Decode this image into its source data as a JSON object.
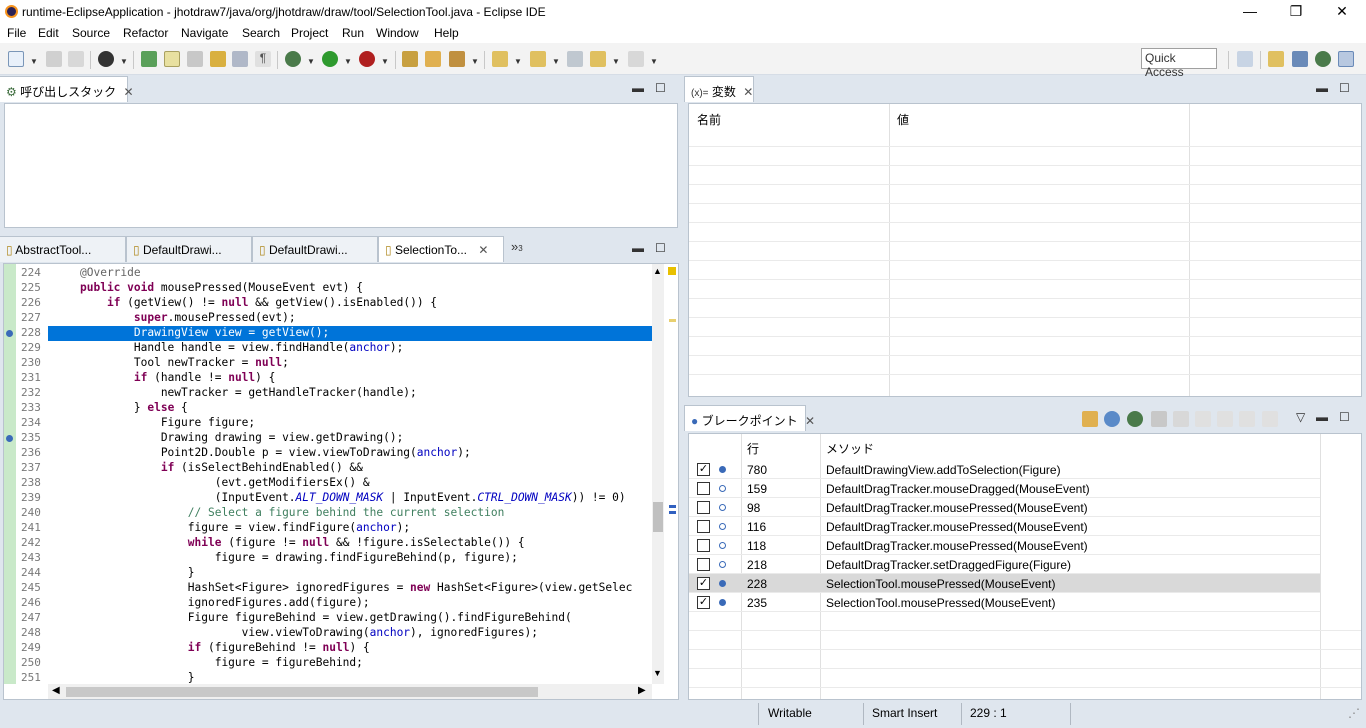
{
  "window": {
    "title": "runtime-EclipseApplication - jhotdraw7/java/org/jhotdraw/draw/tool/SelectionTool.java - Eclipse IDE",
    "minimize": "—",
    "maximize": "❐",
    "close": "✕"
  },
  "menu": [
    "File",
    "Edit",
    "Source",
    "Refactor",
    "Navigate",
    "Search",
    "Project",
    "Run",
    "Window",
    "Help"
  ],
  "toolbar": {
    "quick_access": "Quick Access"
  },
  "callstack": {
    "title": "呼び出しスタック"
  },
  "variables": {
    "title": "変数",
    "prefix": "(x)=",
    "col_name": "名前",
    "col_value": "値"
  },
  "editor": {
    "tabs": [
      "AbstractTool...",
      "DefaultDrawi...",
      "DefaultDrawi...",
      "SelectionTo..."
    ],
    "overflow": "»",
    "overflow_count": "3",
    "highlight_line": "228",
    "lines": [
      {
        "n": "224",
        "t": "@Override"
      },
      {
        "n": "225",
        "t": "public void mousePressed(MouseEvent evt) {"
      },
      {
        "n": "226",
        "t": "    if (getView() != null && getView().isEnabled()) {"
      },
      {
        "n": "227",
        "t": "        super.mousePressed(evt);"
      },
      {
        "n": "228",
        "t": "        DrawingView view = getView();"
      },
      {
        "n": "229",
        "t": "        Handle handle = view.findHandle(anchor);"
      },
      {
        "n": "230",
        "t": "        Tool newTracker = null;"
      },
      {
        "n": "231",
        "t": "        if (handle != null) {"
      },
      {
        "n": "232",
        "t": "            newTracker = getHandleTracker(handle);"
      },
      {
        "n": "233",
        "t": "        } else {"
      },
      {
        "n": "234",
        "t": "            Figure figure;"
      },
      {
        "n": "235",
        "t": "            Drawing drawing = view.getDrawing();"
      },
      {
        "n": "236",
        "t": "            Point2D.Double p = view.viewToDrawing(anchor);"
      },
      {
        "n": "237",
        "t": "            if (isSelectBehindEnabled() &&"
      },
      {
        "n": "238",
        "t": "                    (evt.getModifiersEx() &"
      },
      {
        "n": "239",
        "t": "                    (InputEvent.ALT_DOWN_MASK | InputEvent.CTRL_DOWN_MASK)) != 0)"
      },
      {
        "n": "240",
        "t": "                // Select a figure behind the current selection"
      },
      {
        "n": "241",
        "t": "                figure = view.findFigure(anchor);"
      },
      {
        "n": "242",
        "t": "                while (figure != null && !figure.isSelectable()) {"
      },
      {
        "n": "243",
        "t": "                    figure = drawing.findFigureBehind(p, figure);"
      },
      {
        "n": "244",
        "t": "                }"
      },
      {
        "n": "245",
        "t": "                HashSet<Figure> ignoredFigures = new HashSet<Figure>(view.getSelec"
      },
      {
        "n": "246",
        "t": "                ignoredFigures.add(figure);"
      },
      {
        "n": "247",
        "t": "                Figure figureBehind = view.getDrawing().findFigureBehind("
      },
      {
        "n": "248",
        "t": "                        view.viewToDrawing(anchor), ignoredFigures);"
      },
      {
        "n": "249",
        "t": "                if (figureBehind != null) {"
      },
      {
        "n": "250",
        "t": "                    figure = figureBehind;"
      },
      {
        "n": "251",
        "t": "                }"
      }
    ]
  },
  "breakpoints": {
    "title": "ブレークポイント",
    "col_line": "行",
    "col_method": "メソッド",
    "rows": [
      {
        "checked": true,
        "line": "780",
        "method": "DefaultDrawingView.addToSelection(Figure)"
      },
      {
        "checked": false,
        "line": "159",
        "method": "DefaultDragTracker.mouseDragged(MouseEvent)"
      },
      {
        "checked": false,
        "line": "98",
        "method": "DefaultDragTracker.mousePressed(MouseEvent)"
      },
      {
        "checked": false,
        "line": "116",
        "method": "DefaultDragTracker.mousePressed(MouseEvent)"
      },
      {
        "checked": false,
        "line": "118",
        "method": "DefaultDragTracker.mousePressed(MouseEvent)"
      },
      {
        "checked": false,
        "line": "218",
        "method": "DefaultDragTracker.setDraggedFigure(Figure)"
      },
      {
        "checked": true,
        "line": "228",
        "method": "SelectionTool.mousePressed(MouseEvent)"
      },
      {
        "checked": true,
        "line": "235",
        "method": "SelectionTool.mousePressed(MouseEvent)"
      }
    ],
    "selected_index": 6
  },
  "status": {
    "writable": "Writable",
    "insert_mode": "Smart Insert",
    "position": "229 : 1"
  }
}
